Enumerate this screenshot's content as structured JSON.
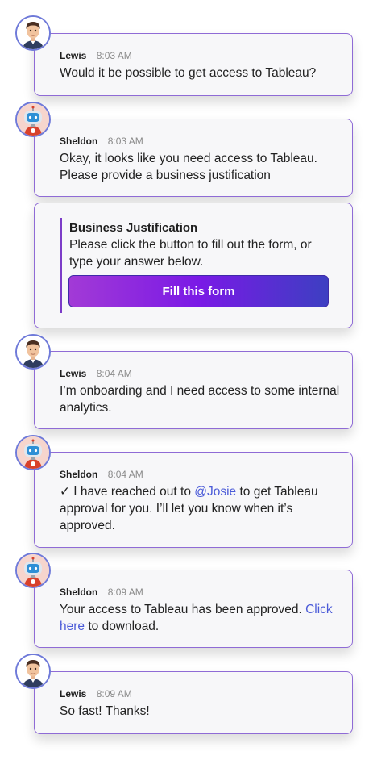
{
  "messages": [
    {
      "name": "Lewis",
      "time": "8:03 AM",
      "text": "Would it be possible to get access to Tableau?"
    },
    {
      "name": "Sheldon",
      "time": "8:03 AM",
      "text": "Okay, it looks like you need access to Tableau. Please provide a business justification"
    },
    {
      "name": "Lewis",
      "time": "8:04 AM",
      "text": "I’m onboarding and I need access to some internal analytics."
    },
    {
      "name": "Sheldon",
      "time": "8:04 AM",
      "text_check": "✓",
      "text_pre": " I have reached out to ",
      "mention": "@Josie",
      "text_post": " to get Tableau approval for you. I’ll let you know when it’s approved."
    },
    {
      "name": "Sheldon",
      "time": "8:09 AM",
      "text_pre": "Your access to Tableau has been approved. ",
      "link": "Click here",
      "text_post": " to download."
    },
    {
      "name": "Lewis",
      "time": "8:09 AM",
      "text": "So fast! Thanks!"
    }
  ],
  "justification": {
    "title": "Business Justification",
    "text": "Please click the button to fill out the form, or type your answer below.",
    "button_label": "Fill this form"
  },
  "colors": {
    "card_border": "#8f6bd6",
    "accent_bar": "#7c3cc8",
    "button_gradient": [
      "#a23ad6",
      "#7a19e6",
      "#3d3fc2"
    ],
    "link": "#4b5bd8"
  },
  "icons": {
    "lewis": "memoji-man-avatar",
    "sheldon": "robot-avatar"
  }
}
